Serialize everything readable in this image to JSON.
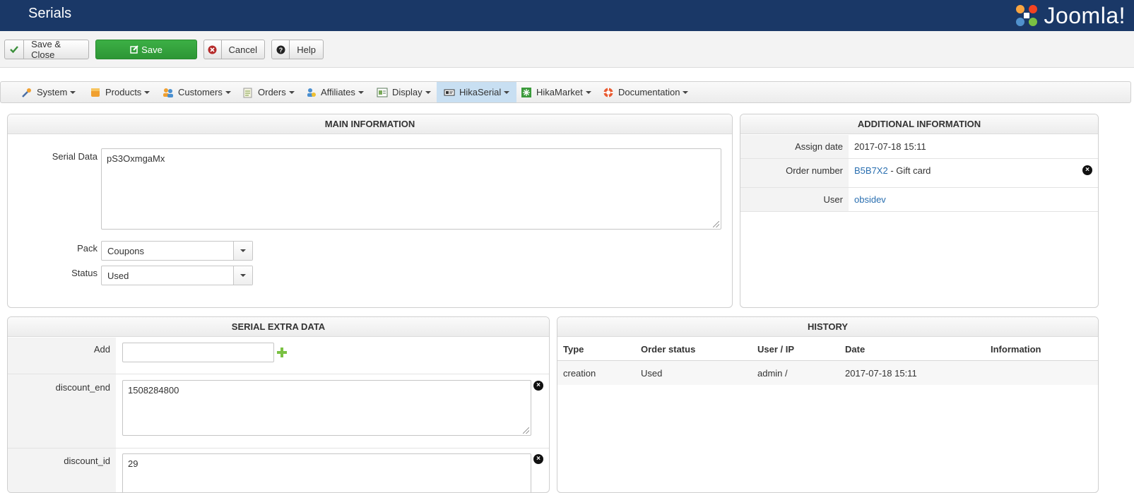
{
  "header": {
    "title": "Serials",
    "brand": "Joomla!"
  },
  "toolbar": {
    "save_close": "Save & Close",
    "save": "Save",
    "cancel": "Cancel",
    "help": "Help"
  },
  "menu": [
    {
      "label": "System",
      "icon": "tools-icon"
    },
    {
      "label": "Products",
      "icon": "box-icon"
    },
    {
      "label": "Customers",
      "icon": "users-icon"
    },
    {
      "label": "Orders",
      "icon": "orders-icon"
    },
    {
      "label": "Affiliates",
      "icon": "affiliates-icon"
    },
    {
      "label": "Display",
      "icon": "display-icon"
    },
    {
      "label": "HikaSerial",
      "icon": "serial-icon",
      "active": true
    },
    {
      "label": "HikaMarket",
      "icon": "market-icon"
    },
    {
      "label": "Documentation",
      "icon": "lifebuoy-icon"
    }
  ],
  "main_info": {
    "title": "MAIN INFORMATION",
    "serial_data_label": "Serial Data",
    "serial_data_value": "pS3OxmgaMx",
    "pack_label": "Pack",
    "pack_value": "Coupons",
    "status_label": "Status",
    "status_value": "Used"
  },
  "additional_info": {
    "title": "ADDITIONAL INFORMATION",
    "assign_date_label": "Assign date",
    "assign_date_value": "2017-07-18 15:11",
    "order_number_label": "Order number",
    "order_number_link": "B5B7X2",
    "order_number_suffix": " - Gift card",
    "user_label": "User",
    "user_value": "obsidev"
  },
  "extra_data": {
    "title": "SERIAL EXTRA DATA",
    "add_label": "Add",
    "add_value": "",
    "fields": [
      {
        "key": "discount_end",
        "value": "1508284800"
      },
      {
        "key": "discount_id",
        "value": "29"
      }
    ]
  },
  "history": {
    "title": "HISTORY",
    "columns": [
      "Type",
      "Order status",
      "User / IP",
      "Date",
      "Information"
    ],
    "rows": [
      [
        "creation",
        "Used",
        "admin /",
        "2017-07-18 15:11",
        ""
      ]
    ]
  },
  "colors": {
    "header_bg": "#1a3867",
    "save_green": "#2d9635",
    "active_menu": "#c8dff2",
    "link": "#2a6fb0"
  }
}
